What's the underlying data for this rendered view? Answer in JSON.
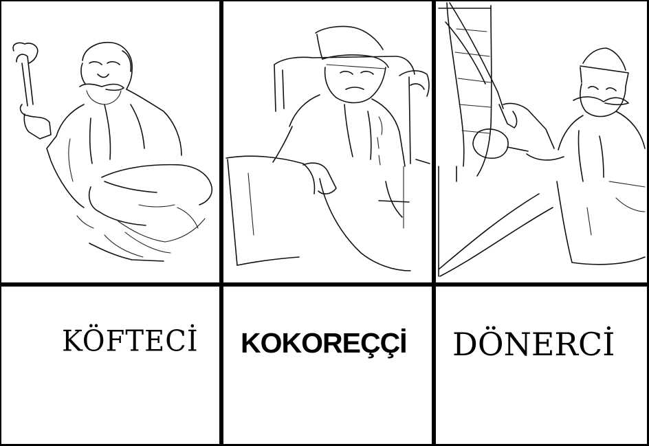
{
  "panels": [
    {
      "id": "kofteci",
      "caption": "KÖFTECİ"
    },
    {
      "id": "kokorecci",
      "caption": "KOKOREÇÇİ"
    },
    {
      "id": "donerci",
      "caption": "DÖNERCİ"
    }
  ],
  "colors": {
    "ink": "#000000",
    "paper": "#ffffff"
  }
}
